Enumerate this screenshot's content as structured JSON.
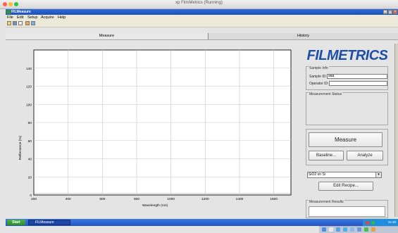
{
  "mac_window": {
    "title": "xp FilmMetrics (Running)"
  },
  "window": {
    "title": "FILMeasure",
    "btn_min": "_",
    "btn_max": "□",
    "btn_close": "×"
  },
  "menu": [
    "File",
    "Edit",
    "Setup",
    "Acquire",
    "Help"
  ],
  "tabs": {
    "measure": "Measure",
    "history": "History"
  },
  "chart_data": {
    "type": "line",
    "xlabel": "Wavelength (nm)",
    "ylabel": "Reflectance (%)",
    "xlim": [
      200,
      1700
    ],
    "ylim": [
      0,
      160
    ],
    "x_ticks": [
      "200",
      "400",
      "600",
      "800",
      "1000",
      "1200",
      "1400",
      "1600"
    ],
    "y_ticks": [
      "0",
      "20",
      "40",
      "60",
      "80",
      "100",
      "120",
      "140"
    ],
    "grid": true,
    "series": []
  },
  "logo": {
    "text": "FILMETRICS"
  },
  "sample_info": {
    "title": "Sample Info",
    "sample_id_label": "Sample ID:",
    "sample_id_value": "aaa",
    "operator_id_label": "Operator ID:",
    "operator_id_value": ""
  },
  "measurement_status": {
    "title": "Measurement Status"
  },
  "buttons": {
    "measure": "Measure",
    "baseline": "Baseline...",
    "analyze": "Analyze",
    "edit_recipe": "Edit Recipe..."
  },
  "recipe": {
    "selected": "SiO2 on Si"
  },
  "results": {
    "title": "Measurement Results"
  },
  "taskbar": {
    "start": "Start",
    "app": "FILMeasure",
    "clock": "15:39"
  },
  "colors": {
    "logo": "#1e4fa8",
    "xp_title": "#2456c2",
    "start": "#3a9a3a"
  }
}
